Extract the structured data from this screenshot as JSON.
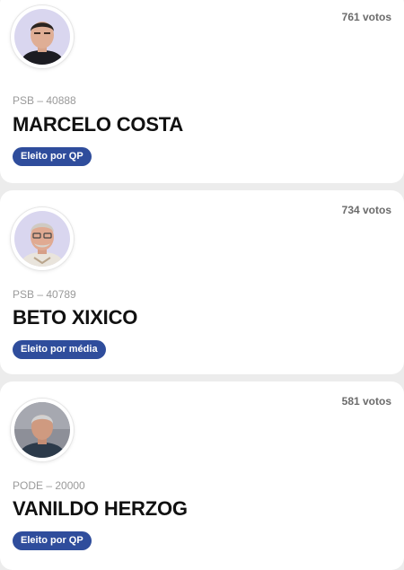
{
  "candidates": [
    {
      "votes": "761 votos",
      "party": "PSB – 40888",
      "name": "MARCELO COSTA",
      "status": "Eleito por QP",
      "photo": "candidate-photo"
    },
    {
      "votes": "734 votos",
      "party": "PSB – 40789",
      "name": "BETO XIXICO",
      "status": "Eleito por média",
      "photo": "candidate-photo"
    },
    {
      "votes": "581 votos",
      "party": "PODE – 20000",
      "name": "VANILDO HERZOG",
      "status": "Eleito por QP",
      "photo": "candidate-photo"
    }
  ],
  "colors": {
    "badge": "#2f4d9c",
    "page_background": "#ececec",
    "card_background": "#ffffff"
  }
}
